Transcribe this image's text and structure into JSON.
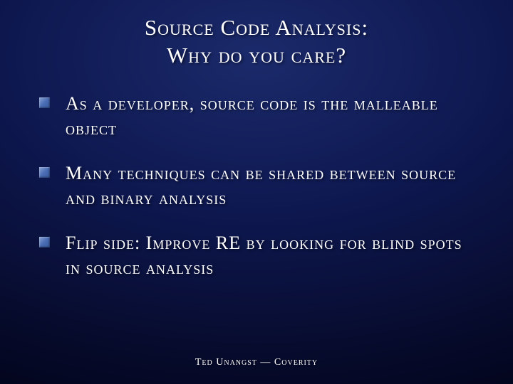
{
  "title": {
    "line1": "Source Code Analysis:",
    "line2": "Why do you care?"
  },
  "bullets": [
    "As a developer, source code is the malleable object",
    "Many techniques can be shared between source and binary analysis",
    "Flip side: Improve RE by looking for blind spots in source analysis"
  ],
  "footer": "Ted Unangst — Coverity"
}
